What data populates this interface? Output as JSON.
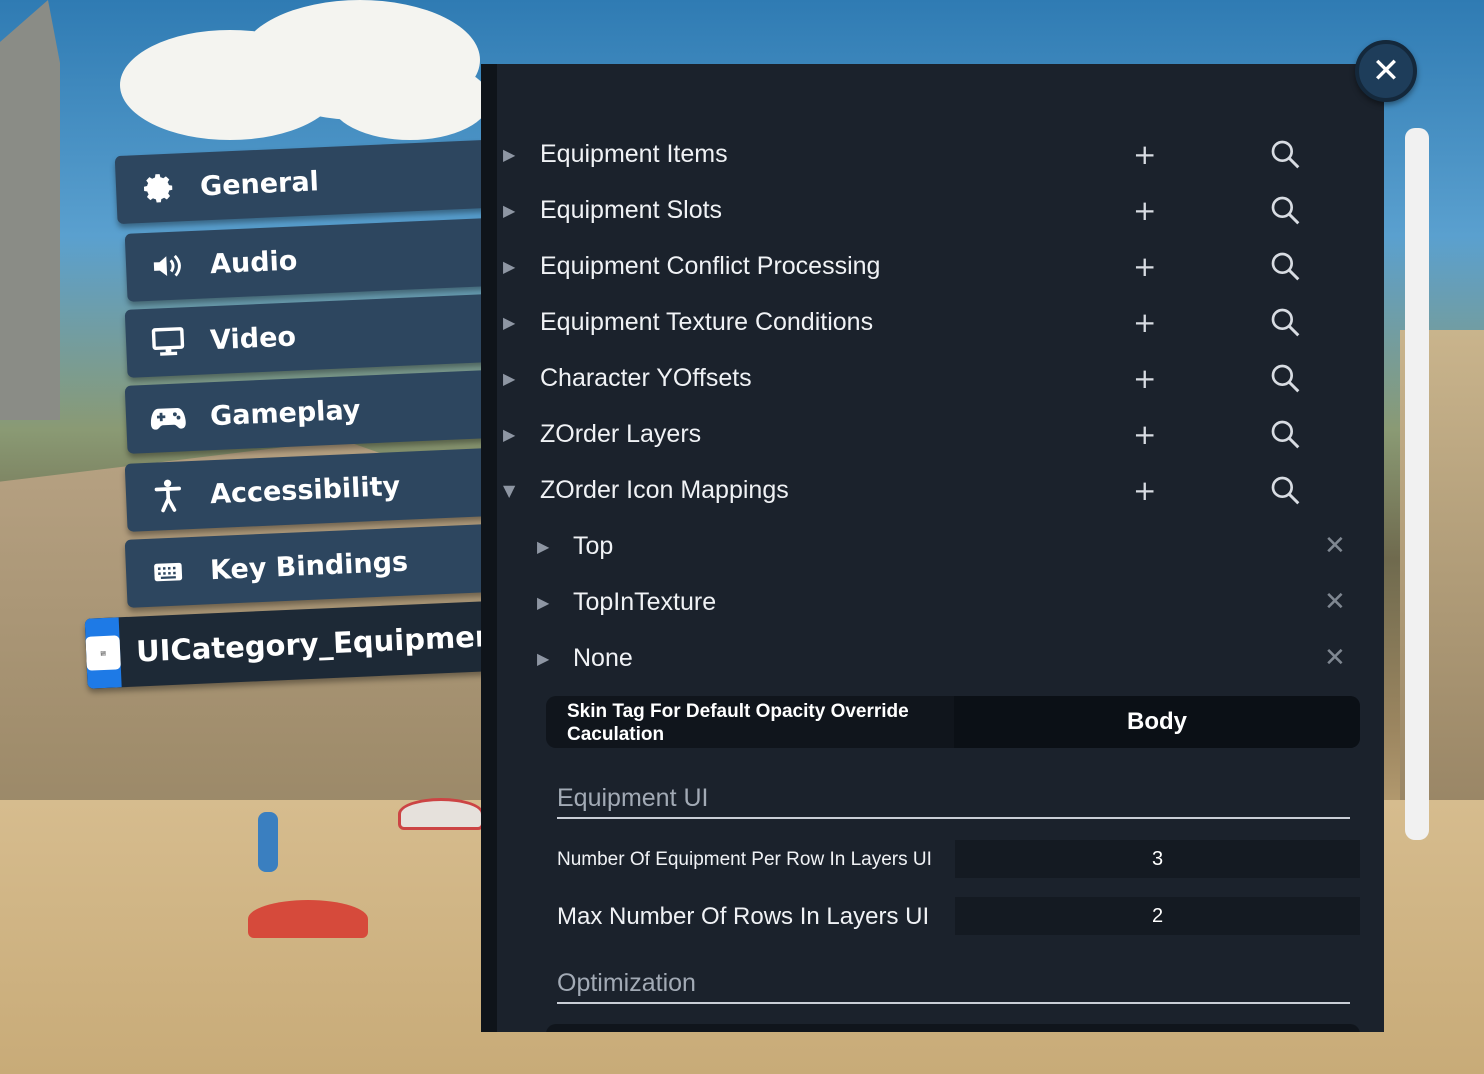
{
  "sidebar": {
    "items": [
      {
        "label": "General",
        "icon": "gear-icon"
      },
      {
        "label": "Audio",
        "icon": "speaker-icon"
      },
      {
        "label": "Video",
        "icon": "monitor-icon"
      },
      {
        "label": "Gameplay",
        "icon": "gamepad-icon"
      },
      {
        "label": "Accessibility",
        "icon": "accessibility-icon"
      },
      {
        "label": "Key Bindings",
        "icon": "keyboard-icon"
      },
      {
        "label": "UICategory_Equipment",
        "icon": "document-icon",
        "active": true
      }
    ]
  },
  "panel": {
    "close_glyph": "✕",
    "groups": [
      {
        "label": "Equipment Items",
        "expanded": false
      },
      {
        "label": "Equipment Slots",
        "expanded": false
      },
      {
        "label": "Equipment Conflict Processing",
        "expanded": false
      },
      {
        "label": "Equipment Texture Conditions",
        "expanded": false
      },
      {
        "label": "Character YOffsets",
        "expanded": false
      },
      {
        "label": "ZOrder Layers",
        "expanded": false
      },
      {
        "label": "ZOrder Icon Mappings",
        "expanded": true
      }
    ],
    "mapping_children": [
      {
        "label": "Top"
      },
      {
        "label": "TopInTexture"
      },
      {
        "label": "None"
      }
    ],
    "add_glyph": "+",
    "remove_glyph": "✕",
    "skin_tag": {
      "label": "Skin Tag For Default Opacity Override Caculation",
      "value": "Body"
    },
    "equipment_ui": {
      "title": "Equipment UI",
      "fields": [
        {
          "label": "Number Of Equipment Per Row In Layers UI",
          "value": "3"
        },
        {
          "label": "Max Number Of Rows In Layers UI",
          "value": "2"
        }
      ]
    },
    "optimization": {
      "title": "Optimization"
    }
  },
  "colors": {
    "active_tab_accent": "#1e7ae6",
    "panel_bg": "#1b222c",
    "tab_bg": "#2d465f"
  }
}
